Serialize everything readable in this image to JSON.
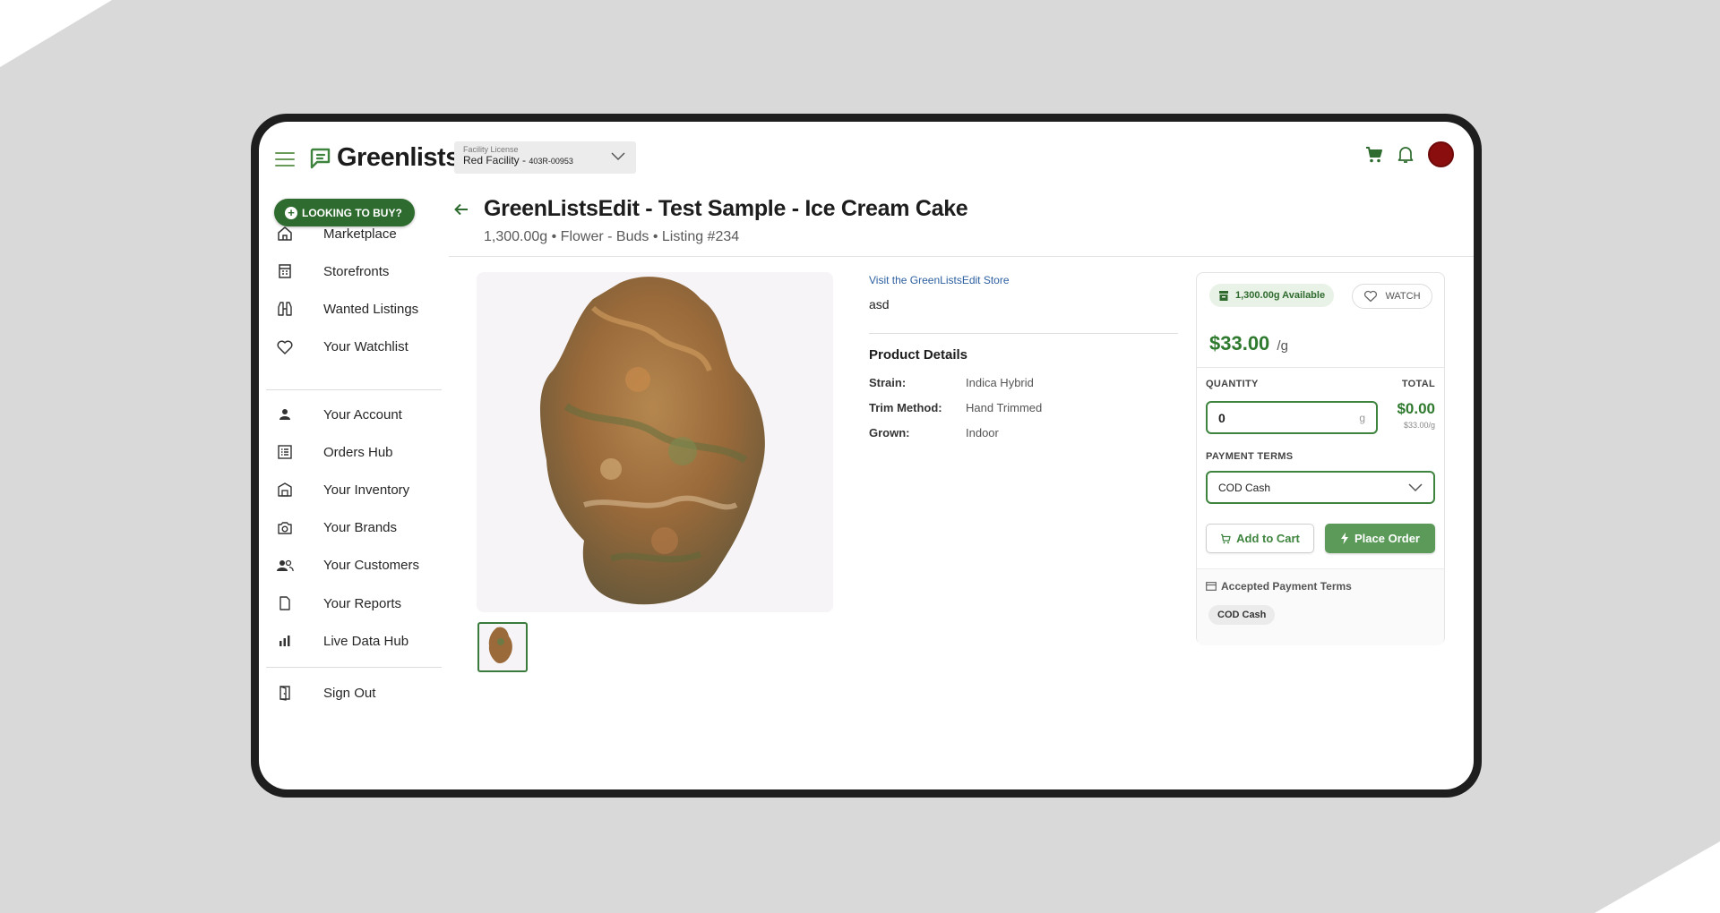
{
  "colors": {
    "brand_green": "#2e6b2e",
    "accent_green": "#3e843e",
    "price_green": "#2f7a2f",
    "avatar": "#8b0e0e"
  },
  "header": {
    "logo_text": "Greenlists",
    "facility_label": "Facility License",
    "facility_name": "Red Facility - ",
    "facility_id": "403R-00953",
    "icons": [
      "menu-icon",
      "cart-icon",
      "bell-icon",
      "avatar"
    ]
  },
  "sidebar": {
    "cta": "LOOKING TO BUY?",
    "items": [
      {
        "label": "Marketplace",
        "icon": "home-icon"
      },
      {
        "label": "Storefronts",
        "icon": "storefront-icon"
      },
      {
        "label": "Wanted Listings",
        "icon": "binoculars-icon"
      },
      {
        "label": "Your Watchlist",
        "icon": "heart-icon"
      },
      {
        "label": "Your Account",
        "icon": "person-icon"
      },
      {
        "label": "Orders Hub",
        "icon": "list-icon"
      },
      {
        "label": "Your Inventory",
        "icon": "warehouse-icon"
      },
      {
        "label": "Your Brands",
        "icon": "camera-icon"
      },
      {
        "label": "Your Customers",
        "icon": "people-icon"
      },
      {
        "label": "Your Reports",
        "icon": "document-icon"
      },
      {
        "label": "Live Data Hub",
        "icon": "bar-chart-icon"
      },
      {
        "label": "Sign Out",
        "icon": "door-icon"
      }
    ]
  },
  "listing": {
    "title": "GreenListsEdit - Test Sample - Ice Cream Cake",
    "subtitle": "1,300.00g • Flower - Buds • Listing #234",
    "store_link": "Visit the GreenListsEdit Store",
    "description": "asd",
    "details_title": "Product Details",
    "details": [
      {
        "key": "Strain:",
        "value": "Indica Hybrid"
      },
      {
        "key": "Trim Method:",
        "value": "Hand Trimmed"
      },
      {
        "key": "Grown:",
        "value": "Indoor"
      }
    ]
  },
  "buy": {
    "available": "1,300.00g Available",
    "watch": "WATCH",
    "price": "$33.00",
    "price_unit": "/g",
    "quantity_label": "QUANTITY",
    "total_label": "TOTAL",
    "quantity_value": "0",
    "quantity_unit": "g",
    "total_value": "$0.00",
    "total_sub": "$33.00/g",
    "payment_label": "PAYMENT TERMS",
    "payment_selected": "COD Cash",
    "add_to_cart": "Add to Cart",
    "place_order": "Place Order",
    "accepted_title": "Accepted Payment Terms",
    "accepted_terms": [
      "COD Cash"
    ]
  }
}
